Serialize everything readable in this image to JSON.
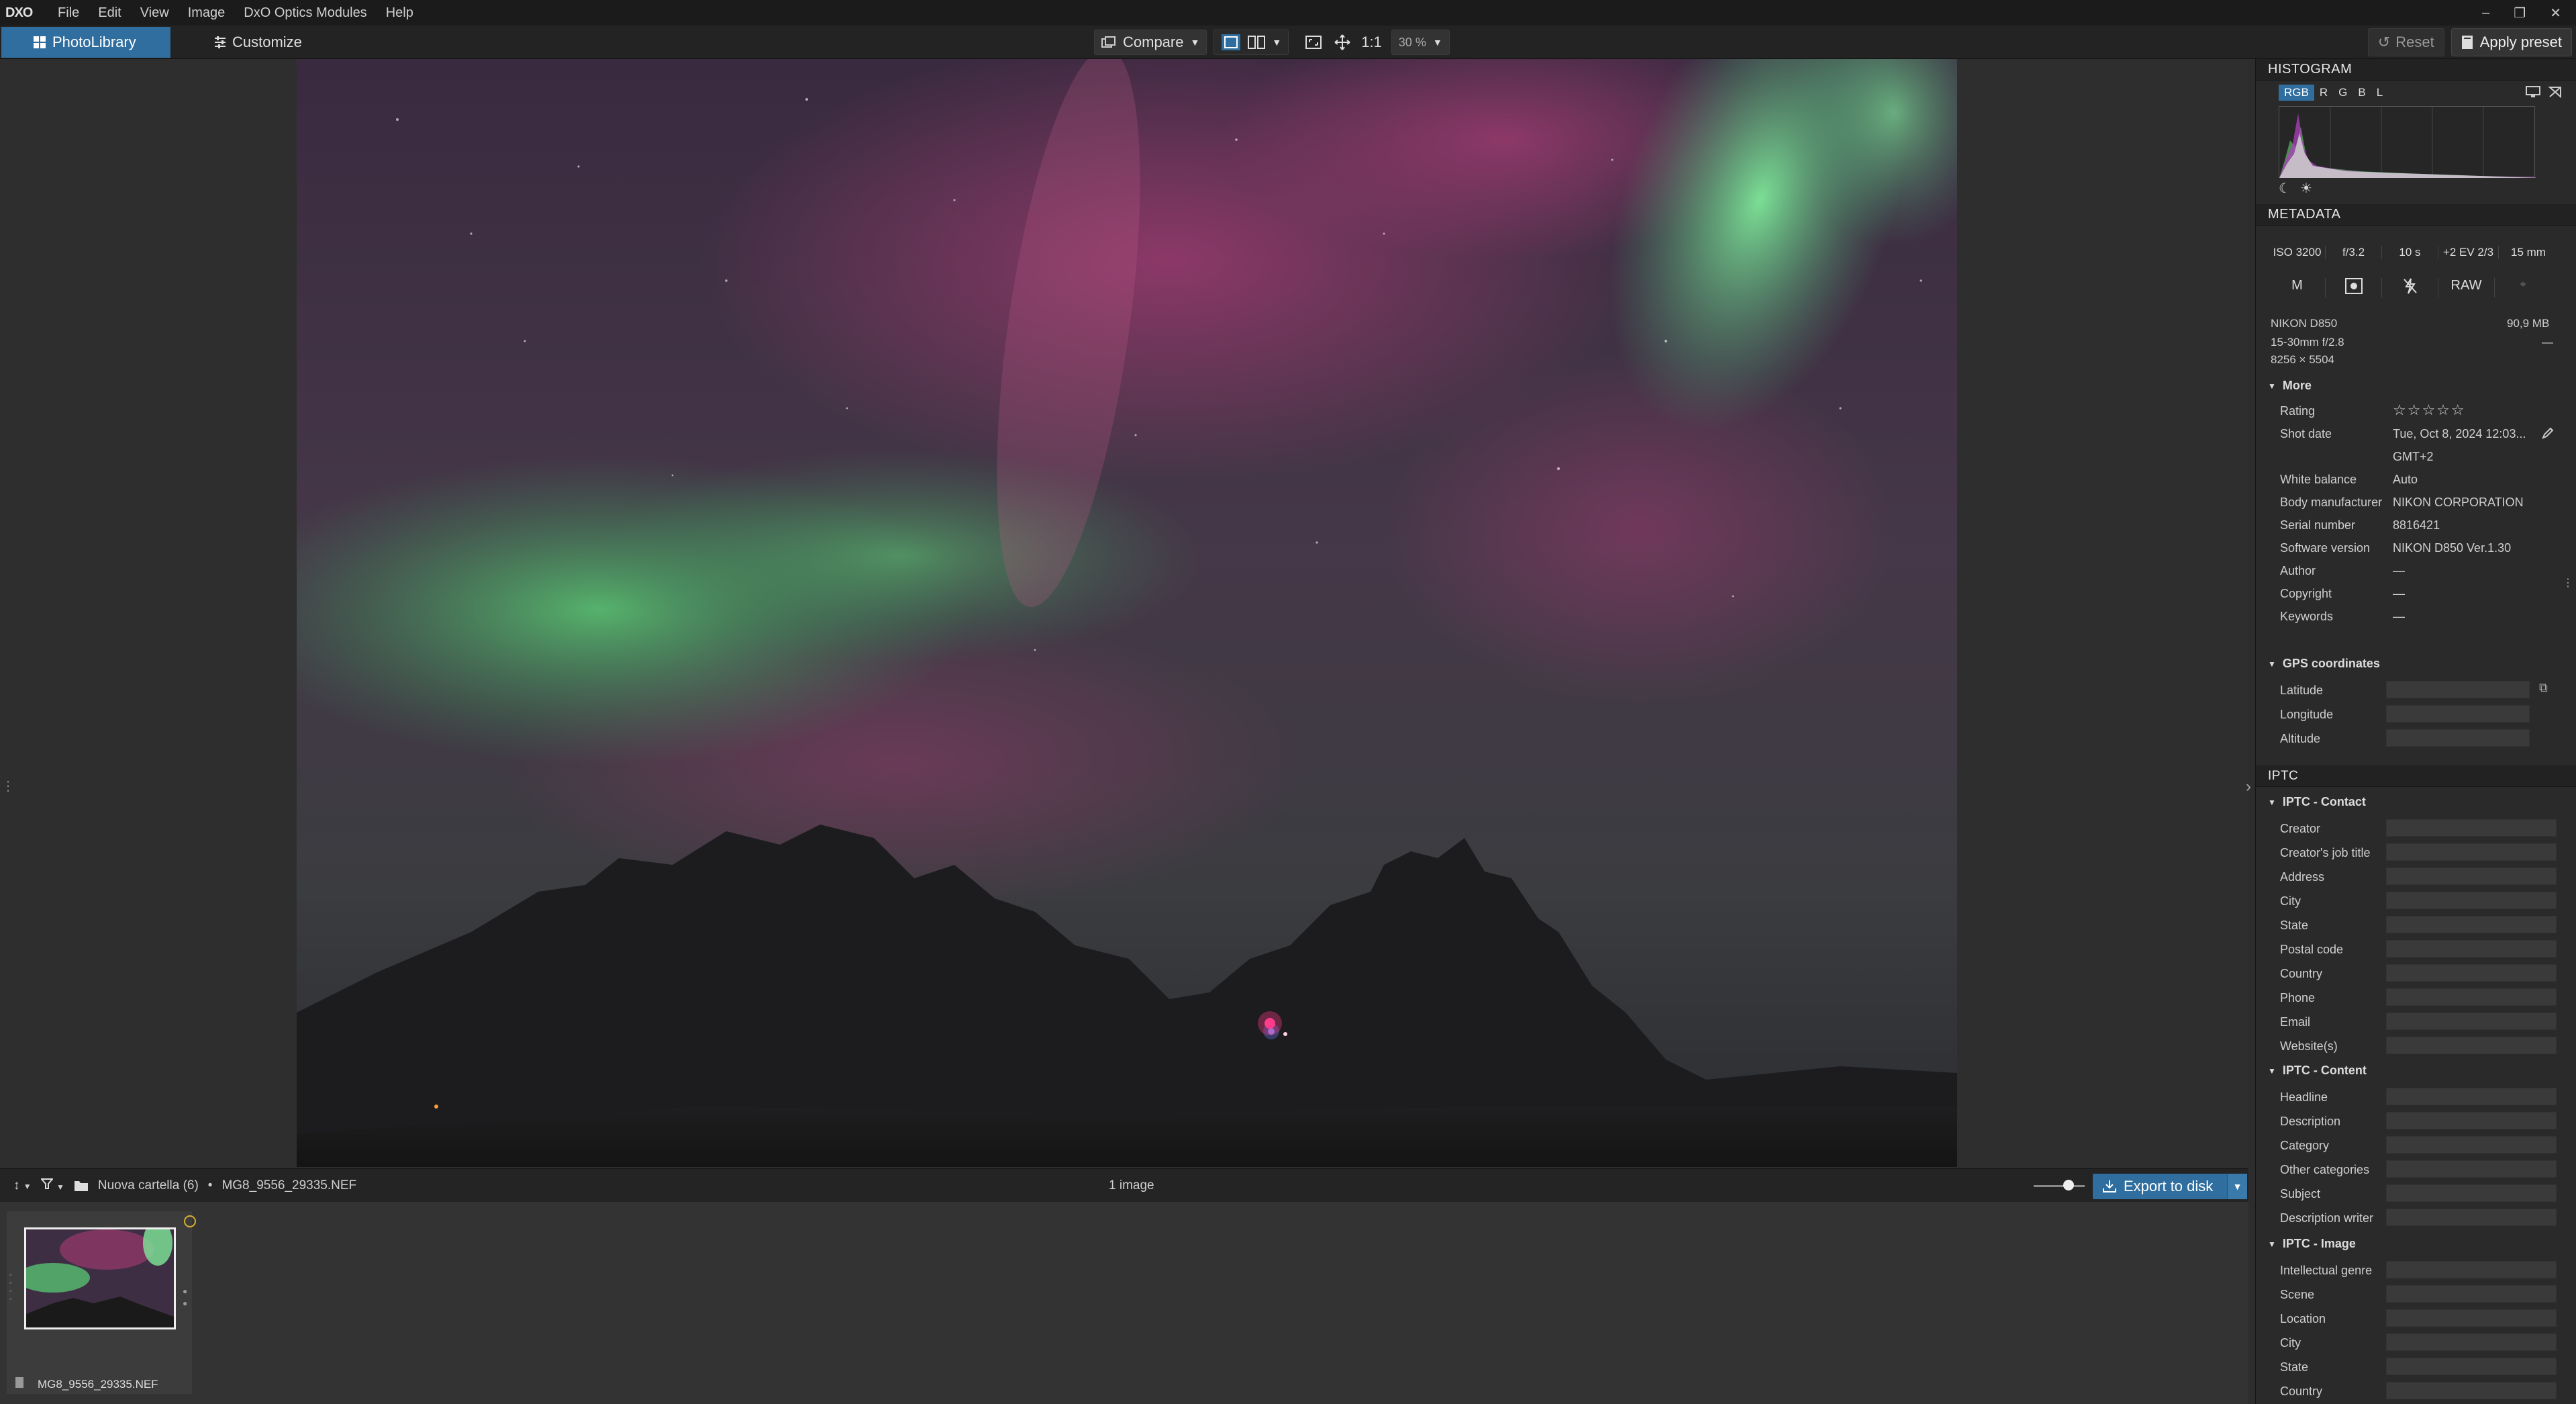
{
  "menubar": {
    "logo": "DXO",
    "items": [
      "File",
      "Edit",
      "View",
      "Image",
      "DxO Optics Modules",
      "Help"
    ],
    "window_controls": [
      "–",
      "❐",
      "✕"
    ]
  },
  "toolbar": {
    "photolibrary": "PhotoLibrary",
    "customize": "Customize",
    "compare": "Compare",
    "one_to_one": "1:1",
    "zoom": "30 %",
    "reset": "Reset",
    "apply_preset": "Apply preset"
  },
  "filmbar": {
    "sort_label": "↕",
    "folder": "Nuova cartella (6)",
    "separator": "•",
    "file": "MG8_9556_29335.NEF",
    "count": "1 image",
    "export": "Export to disk"
  },
  "filmstrip": {
    "items": [
      {
        "name": "MG8_9556_29335.NEF"
      }
    ]
  },
  "histogram": {
    "title": "HISTOGRAM",
    "tabs": [
      "RGB",
      "R",
      "G",
      "B",
      "L"
    ]
  },
  "metadata": {
    "title": "METADATA",
    "exposure": [
      "ISO 3200",
      "f/3.2",
      "10 s",
      "+2 EV 2/3",
      "15 mm"
    ],
    "mode": [
      "M",
      "RAW"
    ],
    "camera": "NIKON D850",
    "size": "90,9 MB",
    "lens": "15-30mm f/2.8",
    "lens_extra": "—",
    "dimensions": "8256 × 5504",
    "more_label": "More",
    "fields": [
      {
        "label": "Rating",
        "value": "☆☆☆☆☆"
      },
      {
        "label": "Shot date",
        "value": "Tue, Oct 8, 2024 12:03..."
      },
      {
        "label": "",
        "value": "GMT+2"
      },
      {
        "label": "White balance",
        "value": "Auto"
      },
      {
        "label": "Body manufacturer",
        "value": "NIKON CORPORATION"
      },
      {
        "label": "Serial number",
        "value": "8816421"
      },
      {
        "label": "Software version",
        "value": "NIKON D850 Ver.1.30"
      },
      {
        "label": "Author",
        "value": "—"
      },
      {
        "label": "Copyright",
        "value": "—"
      },
      {
        "label": "Keywords",
        "value": "—"
      }
    ],
    "gps_label": "GPS coordinates",
    "gps": [
      "Latitude",
      "Longitude",
      "Altitude"
    ]
  },
  "iptc": {
    "title": "IPTC",
    "contact_label": "IPTC - Contact",
    "contact": [
      "Creator",
      "Creator's job title",
      "Address",
      "City",
      "State",
      "Postal code",
      "Country",
      "Phone",
      "Email",
      "Website(s)"
    ],
    "content_label": "IPTC - Content",
    "content": [
      "Headline",
      "Description",
      "Category",
      "Other categories",
      "Subject",
      "Description writer"
    ],
    "image_label": "IPTC - Image",
    "image": [
      "Intellectual genre",
      "Scene",
      "Location",
      "City",
      "State",
      "Country"
    ]
  },
  "colors": {
    "accent": "#2f6e9e",
    "panel": "#2a2a2a"
  }
}
